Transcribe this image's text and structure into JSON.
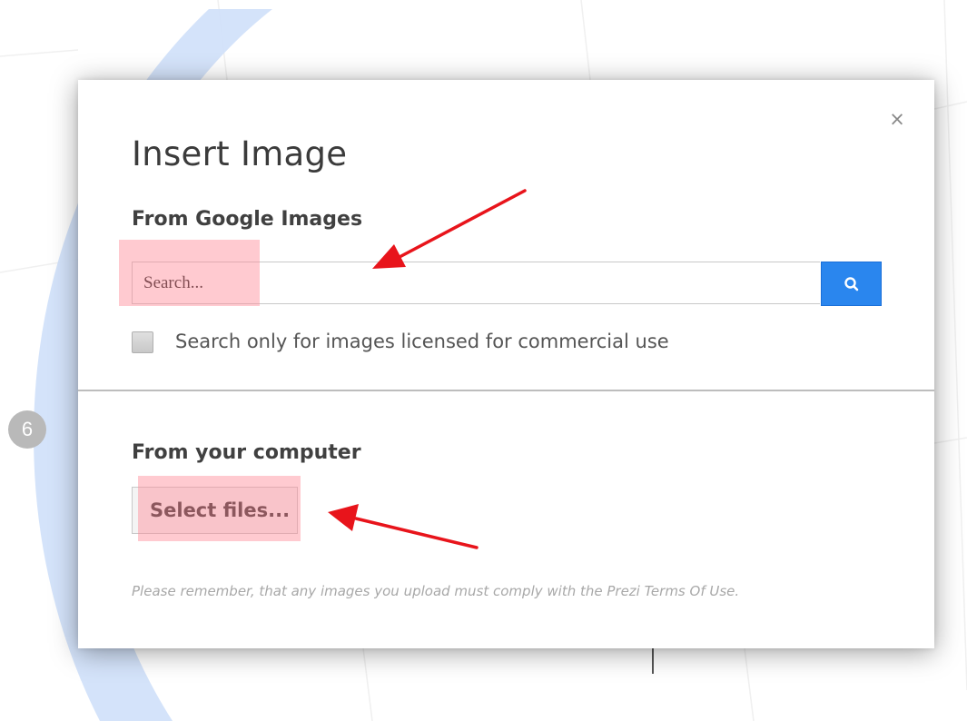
{
  "dialog": {
    "title": "Insert Image",
    "close_label": "×",
    "google_section": {
      "heading": "From Google Images",
      "search_placeholder": "Search...",
      "search_icon": "search-icon",
      "commercial_checkbox_label": "Search only for images licensed for commercial use",
      "commercial_checked": false
    },
    "computer_section": {
      "heading": "From your computer",
      "select_files_label": "Select files...",
      "note": "Please remember, that any images you upload must comply with the Prezi Terms Of Use."
    }
  },
  "canvas": {
    "step_number": "6"
  },
  "colors": {
    "search_button": "#2a86ee",
    "highlight": "#ff8a96",
    "annotation_arrow": "#e8141b",
    "canvas_arc": "#cfe0fa"
  }
}
